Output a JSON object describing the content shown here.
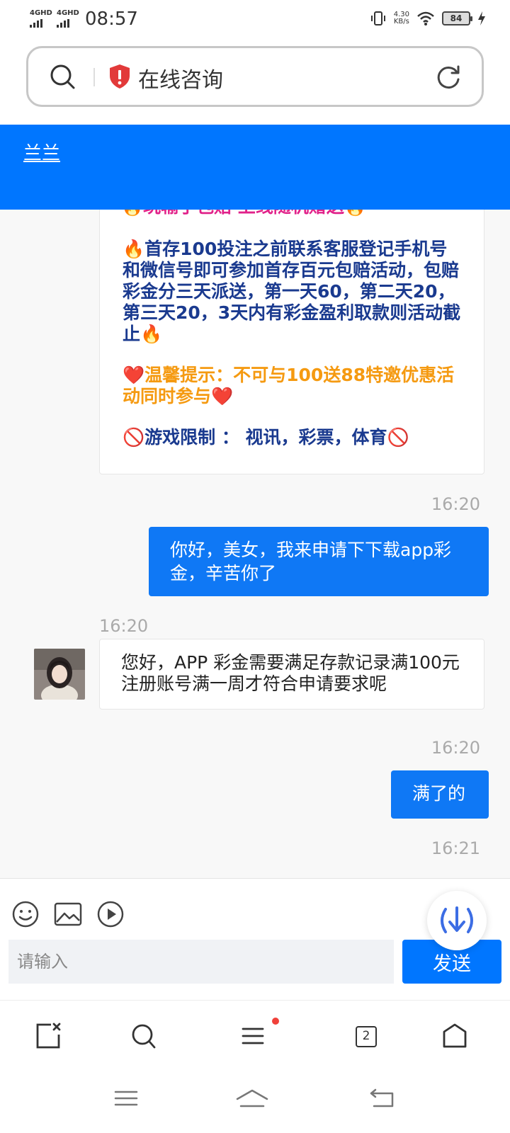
{
  "status_bar": {
    "signal1": "4GHD",
    "signal2": "4GHD",
    "time": "08:57",
    "net_speed_value": "4.30",
    "net_speed_unit": "KB/s",
    "battery": "84"
  },
  "address_bar": {
    "url_text": "在线咨询"
  },
  "chat_header": {
    "agent_name": "兰兰"
  },
  "messages": {
    "promo_cut_line": "🔥玩输了包赔 上线随机赠送🔥",
    "promo_p1": "🔥首存100投注之前联系客服登记手机号和微信号即可参加首存百元包赔活动，包赔彩金分三天派送，第一天60，第二天20，第三天20，3天内有彩金盈利取款则活动截止🔥",
    "promo_p2": "❤️温馨提示：不可与100送88特邀优惠活动同时参与❤️",
    "promo_p3": "🚫游戏限制 ： 视讯，彩票，体育🚫",
    "m1_time": "16:20",
    "m1_text": "你好，美女，我来申请下下载app彩金，辛苦你了",
    "m2_time": "16:20",
    "m2_text": "您好，APP 彩金需要满足存款记录满100元 注册账号满一周才符合申请要求呢",
    "m3_time": "16:20",
    "m3_text": "满了的",
    "m4_time": "16:21"
  },
  "composer": {
    "placeholder": "请输入",
    "send_label": "发送"
  },
  "browser_bar": {
    "tab_count": "2"
  },
  "colors": {
    "accent": "#0076ff",
    "header": "#0076ff",
    "promo_text": "#1a3a8f",
    "warning_text": "#f59a11"
  }
}
